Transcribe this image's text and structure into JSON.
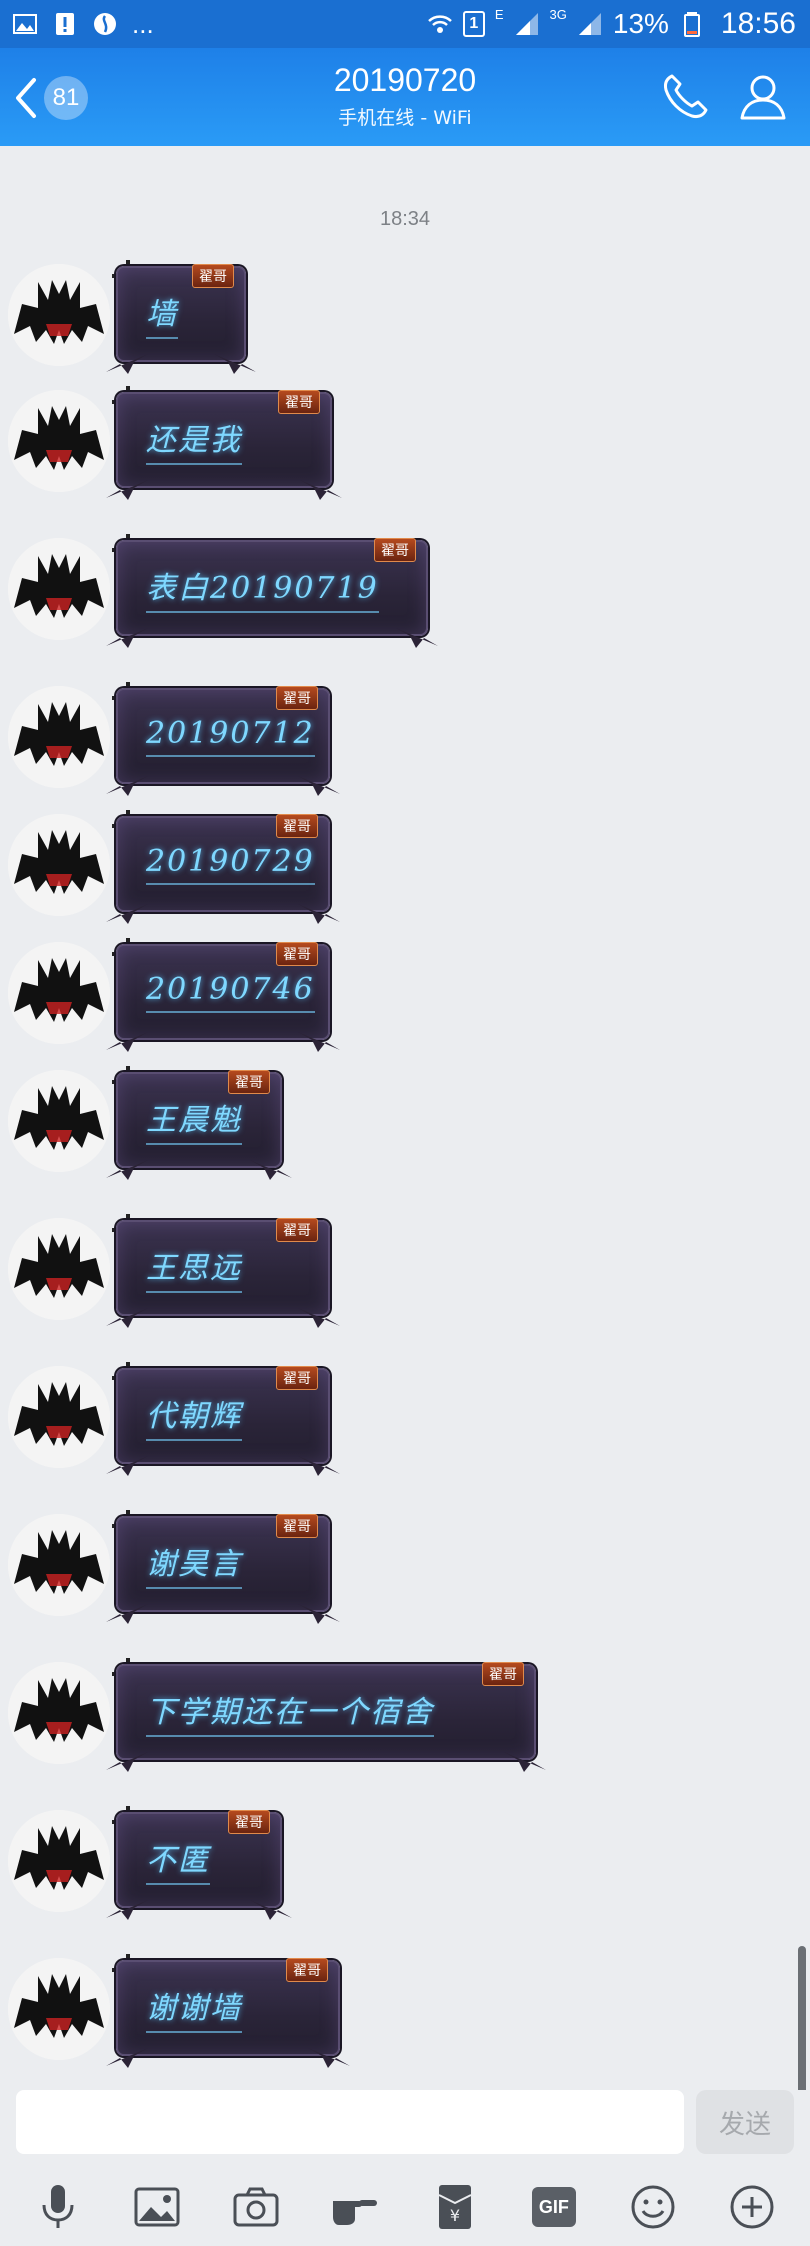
{
  "status_bar": {
    "battery_percent": "13%",
    "time": "18:56",
    "network": "3G",
    "e_label": "E",
    "sim_label": "1",
    "more": "..."
  },
  "header": {
    "unread_count": "81",
    "title": "20190720",
    "subtitle": "手机在线 - WiFi"
  },
  "chat": {
    "timestamp": "18:34",
    "sender_tag": "翟哥",
    "messages": [
      {
        "text": "墙"
      },
      {
        "text": "还是我"
      },
      {
        "text": "表白20190719"
      },
      {
        "text": "20190712"
      },
      {
        "text": "20190729"
      },
      {
        "text": "20190746"
      },
      {
        "text": "王晨魁"
      },
      {
        "text": "王思远"
      },
      {
        "text": "代朝辉"
      },
      {
        "text": "谢昊言"
      },
      {
        "text": "下学期还在一个宿舍"
      },
      {
        "text": "不匿"
      },
      {
        "text": "谢谢墙"
      }
    ]
  },
  "input": {
    "placeholder": "",
    "send_label": "发送"
  },
  "toolbar": {
    "items": [
      "mic-icon",
      "image-icon",
      "camera-icon",
      "pointing-hand-icon",
      "red-envelope-icon",
      "gif-icon",
      "emoji-icon",
      "plus-icon"
    ],
    "gif_label": "GIF"
  },
  "colors": {
    "header_blue": "#1e80e8",
    "bubble_text": "#7fd8ff",
    "bubble_bg": "#2a2438"
  }
}
